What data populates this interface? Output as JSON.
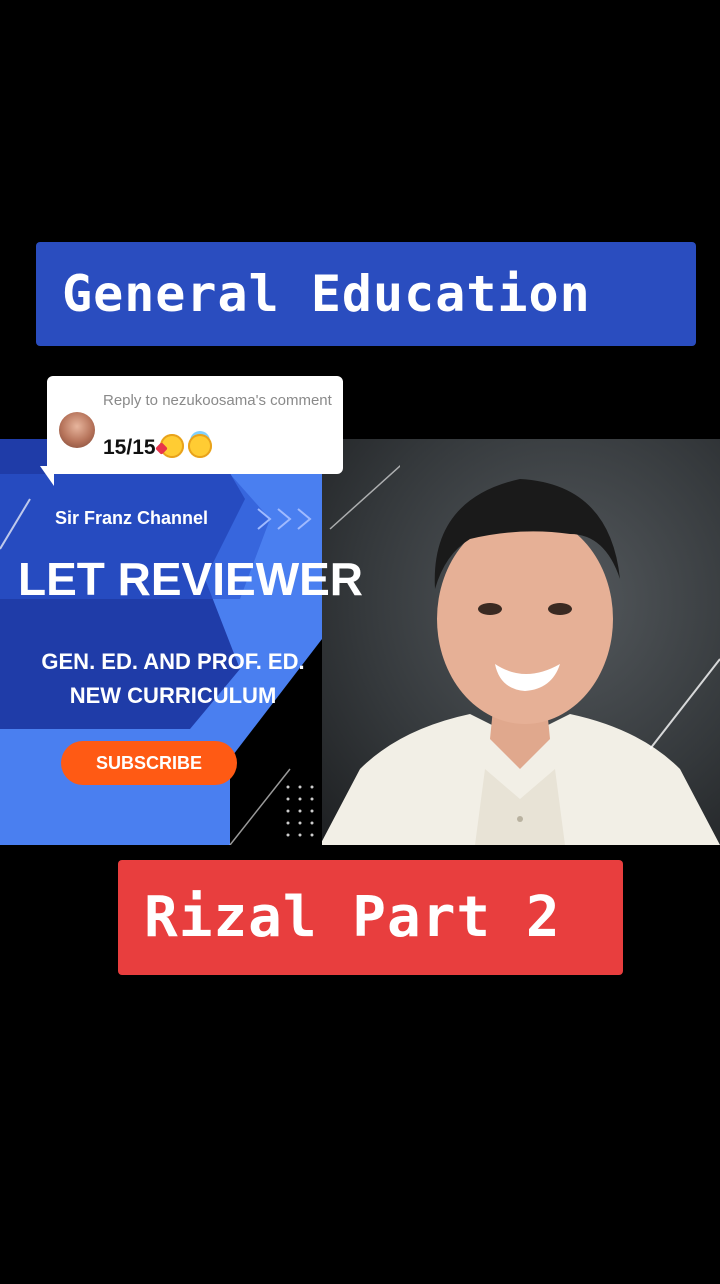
{
  "header_banner": {
    "text": "General Education",
    "color": "#2a4dbf"
  },
  "footer_banner": {
    "text": "Rizal Part 2",
    "color": "#e83e3e"
  },
  "comment": {
    "reply_text": "Reply to nezukoosama's comment",
    "score": "15/15",
    "emojis": [
      "smiling-face-with-hearts-icon",
      "smiling-face-with-halo-icon"
    ]
  },
  "thumbnail": {
    "channel": "Sir Franz Channel",
    "headline": "LET REVIEWER",
    "subline_1": "GEN. ED. AND PROF. ED.",
    "subline_2": "NEW CURRICULUM",
    "subscribe_label": "SUBSCRIBE",
    "accent": "#4a7ff0",
    "subscribe_color": "#ff5a14"
  }
}
